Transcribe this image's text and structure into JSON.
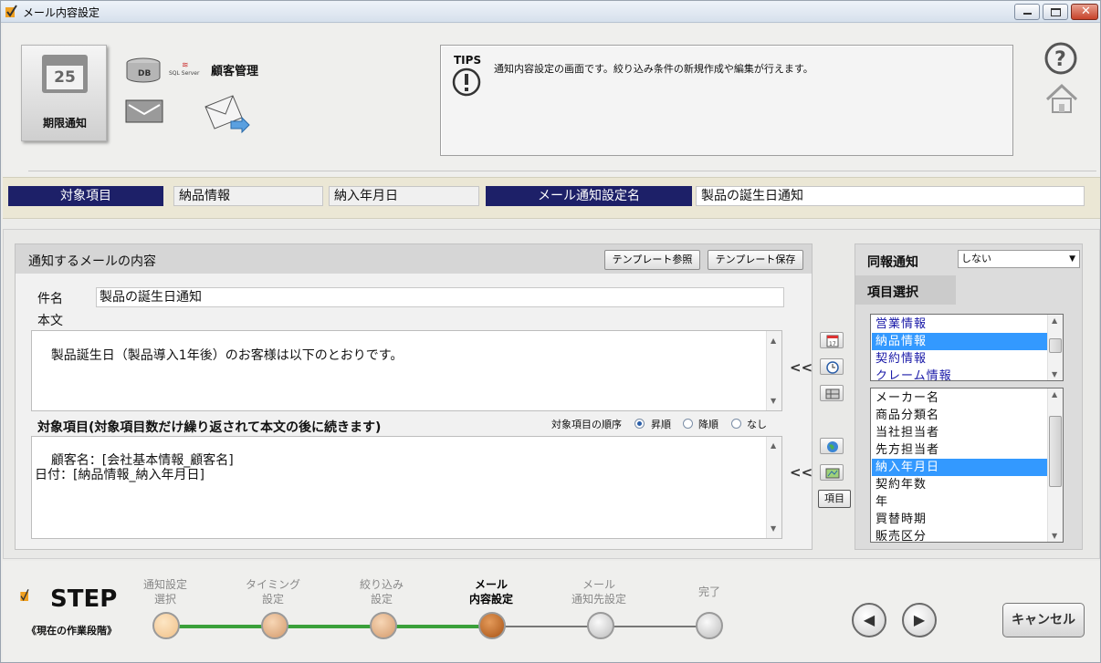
{
  "window": {
    "title": "メール内容設定"
  },
  "header": {
    "tile_label": "期限通知",
    "calendar_day": "25",
    "db_label": "DB",
    "customer_label": "顧客管理",
    "sql_label": "SQL Server"
  },
  "tips": {
    "title": "TIPS",
    "text": "通知内容設定の画面です。絞り込み条件の新規作成や編集が行えます。"
  },
  "info_bar": {
    "target_label": "対象項目",
    "target_value1": "納品情報",
    "target_value2": "納入年月日",
    "setting_name_label": "メール通知設定名",
    "setting_name_value": "製品の誕生日通知"
  },
  "mail": {
    "section_title": "通知するメールの内容",
    "template_ref_button": "テンプレート参照",
    "template_save_button": "テンプレート保存",
    "subject_label": "件名",
    "subject_value": "製品の誕生日通知",
    "body_label": "本文",
    "body_value": "製品誕生日（製品導入1年後）のお客様は以下のとおりです。",
    "items_label": "対象項目(対象項目数だけ繰り返されて本文の後に続きます)",
    "order_label": "対象項目の順序",
    "order_options": [
      "昇順",
      "降順",
      "なし"
    ],
    "order_selected": "昇順",
    "items_value": "顧客名：[会社基本情報_顧客名]\n日付：[納品情報_納入年月日]",
    "insert_arrow": "<<",
    "item_button": "項目"
  },
  "right_panel": {
    "cc_label": "同報通知",
    "cc_value": "しない",
    "item_select_label": "項目選択",
    "categories": [
      "営業情報",
      "納品情報",
      "契約情報",
      "クレーム情報"
    ],
    "categories_selected": 1,
    "fields": [
      "メーカー名",
      "商品分類名",
      "当社担当者",
      "先方担当者",
      "納入年月日",
      "契約年数",
      "年",
      "買替時期",
      "販売区分"
    ],
    "fields_selected": 4
  },
  "steps": {
    "logo_text": "STEP",
    "subtitle": "《現在の作業段階》",
    "items": [
      {
        "line1": "通知設定",
        "line2": "選択"
      },
      {
        "line1": "タイミング",
        "line2": "設定"
      },
      {
        "line1": "絞り込み",
        "line2": "設定"
      },
      {
        "line1": "メール",
        "line2": "内容設定"
      },
      {
        "line1": "メール",
        "line2": "通知先設定"
      },
      {
        "line1": "完了",
        "line2": ""
      }
    ],
    "current_index": 3,
    "cancel_button": "キャンセル"
  },
  "colors": {
    "navy": "#1d2068",
    "selection": "#3399ff",
    "step_done": "#f2c998",
    "step_current": "#c46a25"
  }
}
